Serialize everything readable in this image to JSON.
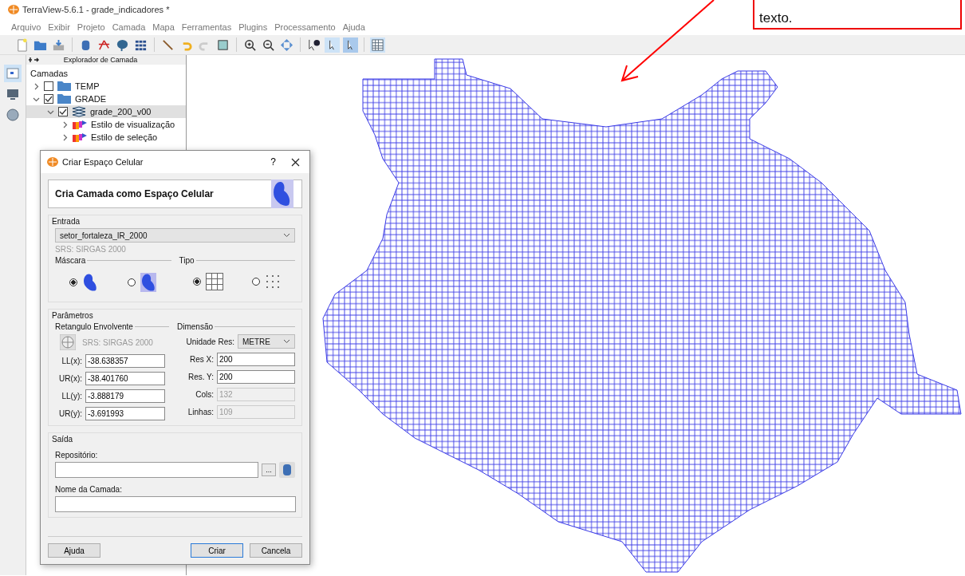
{
  "window": {
    "title": "TerraView-5.6.1 - grade_indicadores *"
  },
  "menu": [
    "Arquivo",
    "Exibir",
    "Projeto",
    "Camada",
    "Mapa",
    "Ferramentas",
    "Plugins",
    "Processamento",
    "Ajuda"
  ],
  "layer_explorer": {
    "title": "Explorador de Camada",
    "root": "Camadas",
    "items": [
      {
        "label": "TEMP",
        "kind": "folder",
        "checked": false,
        "expanded": false,
        "selected": false
      },
      {
        "label": "GRADE",
        "kind": "folder",
        "checked": true,
        "expanded": true,
        "selected": false,
        "children": [
          {
            "label": "grade_200_v00",
            "kind": "layer",
            "checked": true,
            "expanded": true,
            "selected": true,
            "children": [
              {
                "label": "Estilo de visualização",
                "kind": "style",
                "expanded": false,
                "selected": false
              },
              {
                "label": "Estilo de seleção",
                "kind": "style",
                "expanded": false,
                "selected": false
              }
            ]
          }
        ]
      }
    ]
  },
  "dialog": {
    "title": "Criar Espaço Celular",
    "help": "?",
    "header": "Cria Camada como Espaço Celular",
    "input": {
      "label": "Entrada",
      "layer": "setor_fortaleza_IR_2000",
      "srs": "SRS:  SIRGAS 2000",
      "mask": {
        "label": "Máscara",
        "options": [
          {
            "kind": "shape",
            "selected": true
          },
          {
            "kind": "shape-grid",
            "selected": false
          }
        ]
      },
      "type": {
        "label": "Tipo",
        "options": [
          {
            "kind": "cells",
            "selected": true
          },
          {
            "kind": "points",
            "selected": false
          }
        ]
      }
    },
    "params": {
      "label": "Parâmetros",
      "bbox_label": "Retangulo Envolvente",
      "srs": "SRS:  SIRGAS 2000",
      "coords": [
        {
          "label": "LL(x):",
          "value": "-38.638357"
        },
        {
          "label": "UR(x):",
          "value": "-38.401760"
        },
        {
          "label": "LL(y):",
          "value": "-3.888179"
        },
        {
          "label": "UR(y):",
          "value": "-3.691993"
        }
      ],
      "dimension_label": "Dimensão",
      "unit_label": "Unidade Res:",
      "unit": "METRE",
      "dims": [
        {
          "label": "Res X:",
          "value": "200",
          "disabled": false
        },
        {
          "label": "Res. Y:",
          "value": "200",
          "disabled": false
        },
        {
          "label": "Cols:",
          "value": "132",
          "disabled": true
        },
        {
          "label": "Linhas:",
          "value": "109",
          "disabled": true
        }
      ]
    },
    "output": {
      "label": "Saída",
      "repo_label": "Repositório:",
      "browse": "...",
      "name_label": "Nome da Camada:"
    },
    "buttons": [
      {
        "label": "Ajuda",
        "default": false
      },
      {
        "label": "Criar",
        "default": true
      },
      {
        "label": "Cancela",
        "default": false
      }
    ]
  },
  "annotation": {
    "text": "texto."
  }
}
